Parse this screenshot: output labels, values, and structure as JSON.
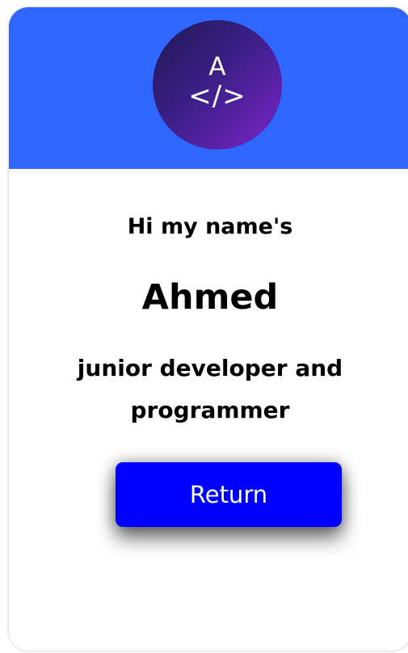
{
  "profile": {
    "avatar_letter": "A",
    "avatar_symbol": "</>",
    "greeting": "Hi my name's",
    "name": "Ahmed",
    "role": "junior developer and programmer"
  },
  "actions": {
    "return_label": "Return"
  },
  "colors": {
    "header": "#2f66ff",
    "button": "#0000ff",
    "avatar_start": "#1f1a55",
    "avatar_end": "#7b25c8"
  },
  "icons": {
    "code": "code-icon"
  }
}
